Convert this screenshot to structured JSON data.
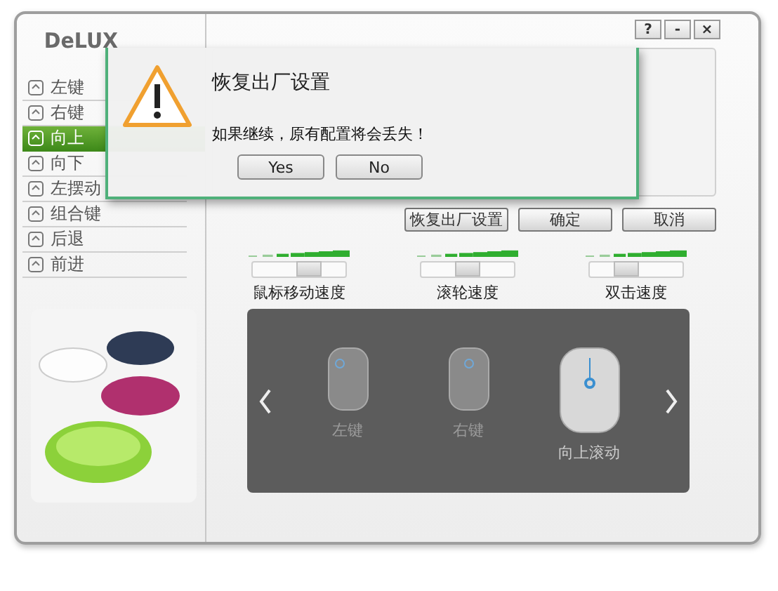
{
  "window": {
    "logo": "DeLUX",
    "title_buttons": [
      "?",
      "-",
      "×"
    ]
  },
  "sidebar": {
    "items": [
      {
        "label": "左键",
        "selected": false
      },
      {
        "label": "右键",
        "selected": false
      },
      {
        "label": "向上",
        "selected": true
      },
      {
        "label": "向下",
        "selected": false
      },
      {
        "label": "左摆动",
        "selected": false
      },
      {
        "label": "组合键",
        "selected": false
      },
      {
        "label": "后退",
        "selected": false
      },
      {
        "label": "前进",
        "selected": false
      }
    ]
  },
  "actions": [
    "恢复出厂设置",
    "确定",
    "取消"
  ],
  "sliders": [
    {
      "label": "鼠标移动速度",
      "level": 0.6
    },
    {
      "label": "滚轮速度",
      "level": 0.5
    },
    {
      "label": "双击速度",
      "level": 0.4
    }
  ],
  "carousel": {
    "items": [
      {
        "label": "左键",
        "selected": false
      },
      {
        "label": "右键",
        "selected": false
      },
      {
        "label": "向上滚动",
        "selected": true
      }
    ]
  },
  "dialog": {
    "title": "恢复出厂设置",
    "message": "如果继续，原有配置将会丢失！",
    "buttons": [
      "Yes",
      "No"
    ]
  }
}
